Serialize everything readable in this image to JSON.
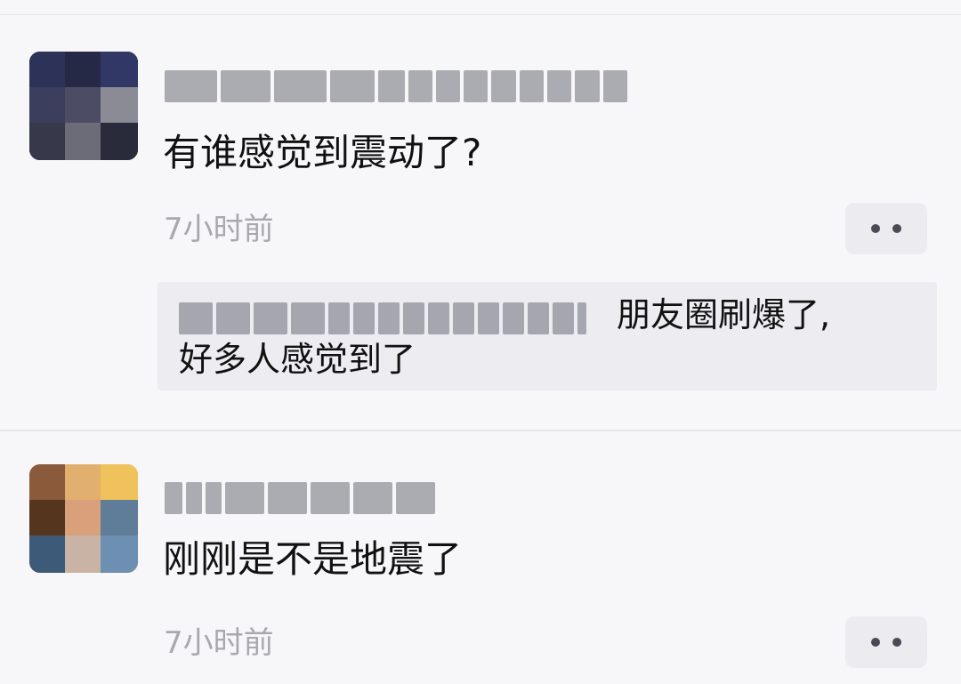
{
  "comments": [
    {
      "text": "有谁感觉到震动了?",
      "time": "7小时前",
      "reply": {
        "text_line_1": "朋友圈刷爆了,",
        "text_line_2": "好多人感觉到了"
      }
    },
    {
      "text": "刚刚是不是地震了",
      "time": "7小时前"
    }
  ],
  "icons": {
    "more": "more-dots-icon"
  },
  "colors": {
    "background": "#f7f7f9",
    "time_text": "#a8a8ae",
    "reply_background": "#ececf1",
    "button_background": "#ececf0"
  }
}
